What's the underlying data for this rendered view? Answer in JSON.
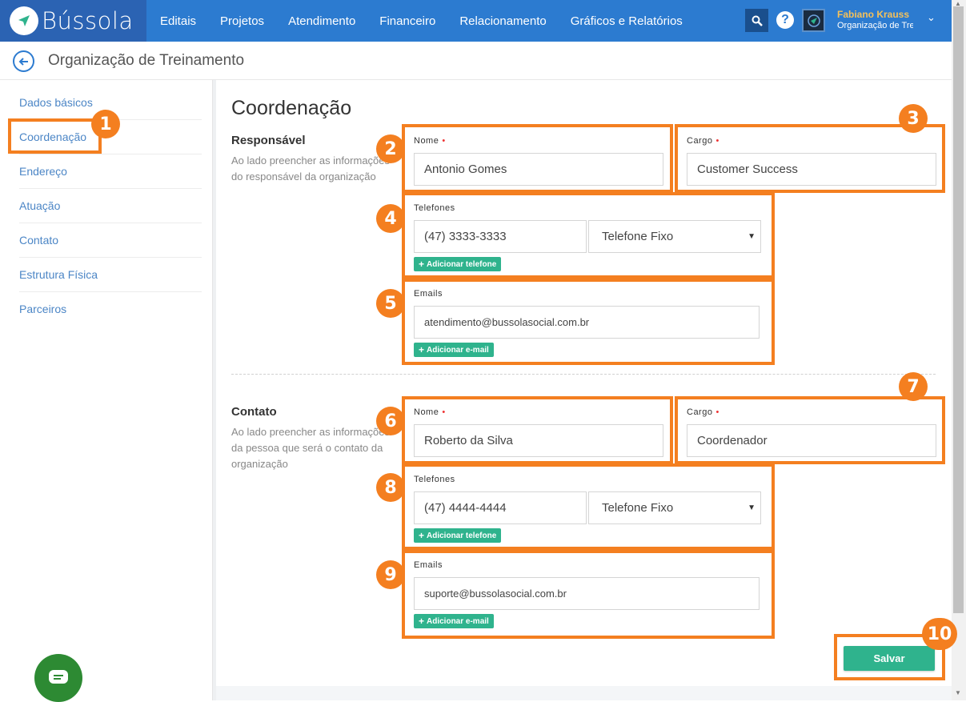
{
  "nav": {
    "brand": "Bússola",
    "menu": [
      "Editais",
      "Projetos",
      "Atendimento",
      "Financeiro",
      "Relacionamento",
      "Gráficos e Relatórios"
    ],
    "user_name": "Fabiano Krauss",
    "user_org": "Organização de Tre"
  },
  "subheader": {
    "title": "Organização de Treinamento"
  },
  "sidebar": {
    "items": [
      "Dados básicos",
      "Coordenação",
      "Endereço",
      "Atuação",
      "Contato",
      "Estrutura Física",
      "Parceiros"
    ],
    "active": "Coordenação"
  },
  "page": {
    "title": "Coordenação"
  },
  "responsavel": {
    "heading": "Responsável",
    "description": "Ao lado preencher as informações do responsável da organização",
    "nome_label": "Nome",
    "nome_value": "Antonio Gomes",
    "cargo_label": "Cargo",
    "cargo_value": "Customer Success",
    "telefones_label": "Telefones",
    "telefone_value": "(47) 3333-3333",
    "telefone_tipo": "Telefone Fixo",
    "add_phone": "Adicionar telefone",
    "emails_label": "Emails",
    "email_value": "atendimento@bussolasocial.com.br",
    "add_email": "Adicionar e-mail"
  },
  "contato": {
    "heading": "Contato",
    "description": "Ao lado preencher as informações da pessoa que será o contato da organização",
    "nome_label": "Nome",
    "nome_value": "Roberto da Silva",
    "cargo_label": "Cargo",
    "cargo_value": "Coordenador",
    "telefones_label": "Telefones",
    "telefone_value": "(47) 4444-4444",
    "telefone_tipo": "Telefone Fixo",
    "add_phone": "Adicionar telefone",
    "emails_label": "Emails",
    "email_value": "suporte@bussolasocial.com.br",
    "add_email": "Adicionar e-mail"
  },
  "save_label": "Salvar",
  "callouts": [
    "1",
    "2",
    "3",
    "4",
    "5",
    "6",
    "7",
    "8",
    "9",
    "10"
  ],
  "colors": {
    "primary": "#2c7bd0",
    "brand_dark": "#2b63b3",
    "accent_green": "#2fb38d",
    "callout_orange": "#f47f20",
    "user_name": "#f5c15a"
  }
}
